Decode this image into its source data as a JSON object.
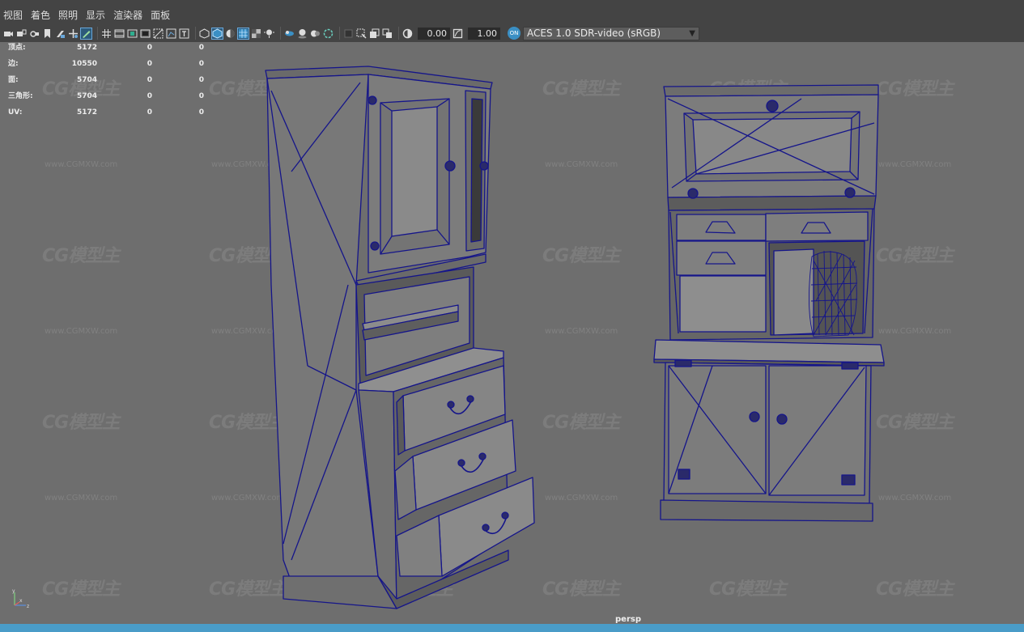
{
  "menubar": {
    "items": [
      "视图",
      "着色",
      "照明",
      "显示",
      "渲染器",
      "面板"
    ]
  },
  "toolbar": {
    "groups": [
      [
        "camera-select-icon",
        "camera-lock-icon",
        "camera-attributes-icon",
        "bookmark-icon",
        "image-plane-icon",
        "pan-zoom-icon",
        "grease-pencil-icon"
      ],
      [
        "grid-icon",
        "film-gate-icon",
        "resolution-gate-icon",
        "gate-mask-icon",
        "field-chart-icon",
        "safe-action-icon",
        "safe-title-icon"
      ],
      [
        "wireframe-icon",
        "smooth-shade-icon",
        "wireframe-on-shaded-icon",
        "textured-icon",
        "use-lights-icon",
        "shadows-icon"
      ],
      [
        "screen-space-ao-icon",
        "motion-blur-icon",
        "multisample-aa-icon",
        "depth-of-field-icon"
      ],
      [
        "isolate-select-icon",
        "xray-icon",
        "xray-joints-icon",
        "xray-components-icon"
      ]
    ],
    "exposure_icon": "exposure-icon",
    "exposure": "0.00",
    "gamma_icon": "gamma-icon",
    "gamma": "1.00",
    "cm_toggle_label": "ON",
    "color_space": "ACES 1.0 SDR-video (sRGB)"
  },
  "hud": {
    "rows": [
      {
        "label": "顶点:",
        "c1": "5172",
        "c2": "0",
        "c3": "0"
      },
      {
        "label": "边:",
        "c1": "10550",
        "c2": "0",
        "c3": "0"
      },
      {
        "label": "面:",
        "c1": "5704",
        "c2": "0",
        "c3": "0"
      },
      {
        "label": "三角形:",
        "c1": "5704",
        "c2": "0",
        "c3": "0"
      },
      {
        "label": "UV:",
        "c1": "5172",
        "c2": "0",
        "c3": "0"
      }
    ]
  },
  "watermark": {
    "logo_text": "CG模型主",
    "url_text": "www.CGMXW.com"
  },
  "viewport": {
    "camera": "persp"
  },
  "axis": {
    "x": "x",
    "y": "y",
    "z": "z"
  },
  "colors": {
    "wire": "#1a1a8c",
    "viewport_bg": "#6e6e6e",
    "accent": "#4a9cc8"
  }
}
